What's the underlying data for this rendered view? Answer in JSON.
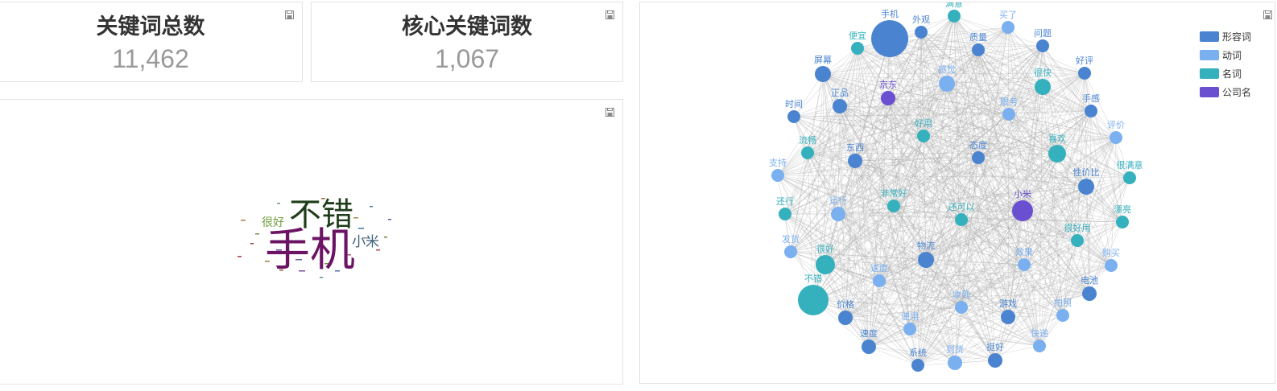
{
  "kpi1": {
    "title": "关键词总数",
    "value": "11,462"
  },
  "kpi2": {
    "title": "核心关键词数",
    "value": "1,067"
  },
  "wordcloud": {
    "words": [
      {
        "text": "手机",
        "color": "#6b1464"
      },
      {
        "text": "不错",
        "color": "#1f3d1a"
      },
      {
        "text": "小米",
        "color": "#3b5f7a"
      },
      {
        "text": "很好",
        "color": "#6f9d3c"
      }
    ]
  },
  "graph": {
    "legend": [
      {
        "label": "形容词",
        "color": "#4a84d0"
      },
      {
        "label": "动词",
        "color": "#7ab0f0"
      },
      {
        "label": "名词",
        "color": "#35b0bd"
      },
      {
        "label": "公司名",
        "color": "#6a4fd0"
      }
    ],
    "nodes": [
      {
        "label": "手机",
        "cat": 0
      },
      {
        "label": "外观",
        "cat": 0
      },
      {
        "label": "满意",
        "cat": 2
      },
      {
        "label": "买了",
        "cat": 1
      },
      {
        "label": "问题",
        "cat": 0
      },
      {
        "label": "好评",
        "cat": 0
      },
      {
        "label": "质量",
        "cat": 0
      },
      {
        "label": "便宜",
        "cat": 2
      },
      {
        "label": "屏幕",
        "cat": 0
      },
      {
        "label": "京东",
        "cat": 3
      },
      {
        "label": "感觉",
        "cat": 1
      },
      {
        "label": "很快",
        "cat": 2
      },
      {
        "label": "正品",
        "cat": 0
      },
      {
        "label": "时间",
        "cat": 0
      },
      {
        "label": "手感",
        "cat": 0
      },
      {
        "label": "服务",
        "cat": 1
      },
      {
        "label": "好用",
        "cat": 2
      },
      {
        "label": "评价",
        "cat": 1
      },
      {
        "label": "流畅",
        "cat": 2
      },
      {
        "label": "东西",
        "cat": 0
      },
      {
        "label": "态度",
        "cat": 0
      },
      {
        "label": "喜欢",
        "cat": 2
      },
      {
        "label": "支持",
        "cat": 1
      },
      {
        "label": "很满意",
        "cat": 2
      },
      {
        "label": "性价比",
        "cat": 0
      },
      {
        "label": "非常好",
        "cat": 2
      },
      {
        "label": "还可以",
        "cat": 2
      },
      {
        "label": "小米",
        "cat": 3
      },
      {
        "label": "还行",
        "cat": 2
      },
      {
        "label": "运行",
        "cat": 1
      },
      {
        "label": "漂亮",
        "cat": 2
      },
      {
        "label": "很好用",
        "cat": 2
      },
      {
        "label": "发货",
        "cat": 1
      },
      {
        "label": "很好",
        "cat": 2
      },
      {
        "label": "物流",
        "cat": 0
      },
      {
        "label": "购买",
        "cat": 1
      },
      {
        "label": "速度",
        "cat": 1
      },
      {
        "label": "电池",
        "cat": 0
      },
      {
        "label": "不错",
        "cat": 2
      },
      {
        "label": "价格",
        "cat": 0
      },
      {
        "label": "拍照",
        "cat": 1
      },
      {
        "label": "收到",
        "cat": 1
      },
      {
        "label": "游戏",
        "cat": 0
      },
      {
        "label": "快递",
        "cat": 1
      },
      {
        "label": "系统",
        "cat": 0
      },
      {
        "label": "使用",
        "cat": 1
      },
      {
        "label": "挺好",
        "cat": 0
      },
      {
        "label": "效果",
        "cat": 1
      },
      {
        "label": "速度",
        "cat": 0
      },
      {
        "label": "到货",
        "cat": 1
      }
    ]
  }
}
